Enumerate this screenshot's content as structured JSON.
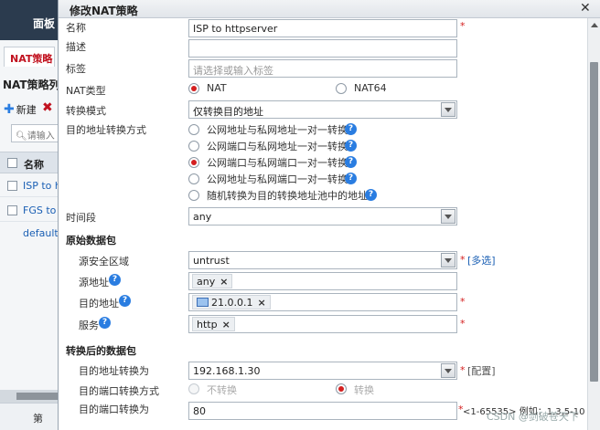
{
  "background": {
    "top_label": "面板",
    "tab_label": "NAT策略",
    "list_title": "NAT策略列",
    "new_label": "新建",
    "search_placeholder": "请输入",
    "column_name": "名称",
    "rows": [
      "ISP to h",
      "FGS to",
      "default"
    ],
    "pager_label": "第"
  },
  "dialog": {
    "title": "修改NAT策略",
    "fields": {
      "name_label": "名称",
      "name_value": "ISP to httpserver",
      "desc_label": "描述",
      "desc_value": "",
      "tag_label": "标签",
      "tag_placeholder": "请选择或输入标签",
      "nat_type_label": "NAT类型",
      "nat_type_options": [
        "NAT",
        "NAT64"
      ],
      "mode_label": "转换模式",
      "mode_value": "仅转换目的地址",
      "dest_mode_label": "目的地址转换方式",
      "dest_mode_options": [
        "公网地址与私网地址一对一转换",
        "公网端口与私网地址一对一转换",
        "公网端口与私网端口一对一转换",
        "公网地址与私网端口一对一转换",
        "随机转换为目的转换地址池中的地址"
      ],
      "time_label": "时间段",
      "time_value": "any",
      "orig_section": "原始数据包",
      "src_zone_label": "源安全区域",
      "src_zone_value": "untrust",
      "multi_select": "[多选]",
      "src_addr_label": "源地址",
      "src_addr_tag": "any",
      "dst_addr_label": "目的地址",
      "dst_addr_tag": "21.0.0.1",
      "service_label": "服务",
      "service_tag": "http",
      "after_section": "转换后的数据包",
      "dst_to_label": "目的地址转换为",
      "dst_to_value": "192.168.1.30",
      "config_link": "[配置]",
      "dst_port_mode_label": "目的端口转换方式",
      "port_mode_options": [
        "不转换",
        "转换"
      ],
      "dst_port_to_label": "目的端口转换为",
      "dst_port_to_value": "80",
      "port_hint": "<1-65535> 例如：1,3,5-10"
    }
  },
  "watermark": "CSDN @剑破苍天下",
  "colors": {
    "accent": "#d42020",
    "link": "#1a5fb4",
    "help": "#2a7de1"
  }
}
